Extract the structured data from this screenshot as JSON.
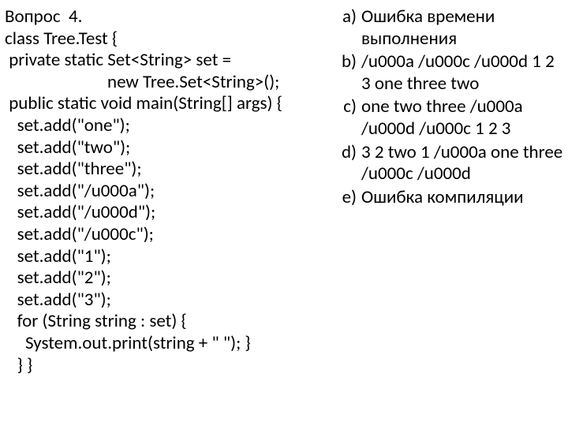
{
  "question": {
    "title": "Вопрос  4.",
    "lines": [
      "class Tree.Test {",
      " private static Set<String> set =",
      "                         new Tree.Set<String>();",
      " public static void main(String[] args) {",
      "   set.add(\"one\");",
      "   set.add(\"two\");",
      "   set.add(\"three\");",
      "   set.add(\"/u000a\");",
      "   set.add(\"/u000d\");",
      "   set.add(\"/u000c\");",
      "   set.add(\"1\");",
      "   set.add(\"2\");",
      "   set.add(\"3\");",
      "   for (String string : set) {",
      "     System.out.print(string + \" \"); }",
      "   } }"
    ]
  },
  "answers": [
    {
      "marker": "a)",
      "text": "Ошибка времени выполнения"
    },
    {
      "marker": "b)",
      "text": "/u000a /u000c /u000d 1 2 3 one three two"
    },
    {
      "marker": "c)",
      "text": "one two three /u000a /u000d /u000c 1 2 3"
    },
    {
      "marker": "d)",
      "text": "3 2 two 1 /u000a one three /u000c /u000d"
    },
    {
      "marker": "e)",
      "text": "Ошибка компиляции"
    }
  ]
}
